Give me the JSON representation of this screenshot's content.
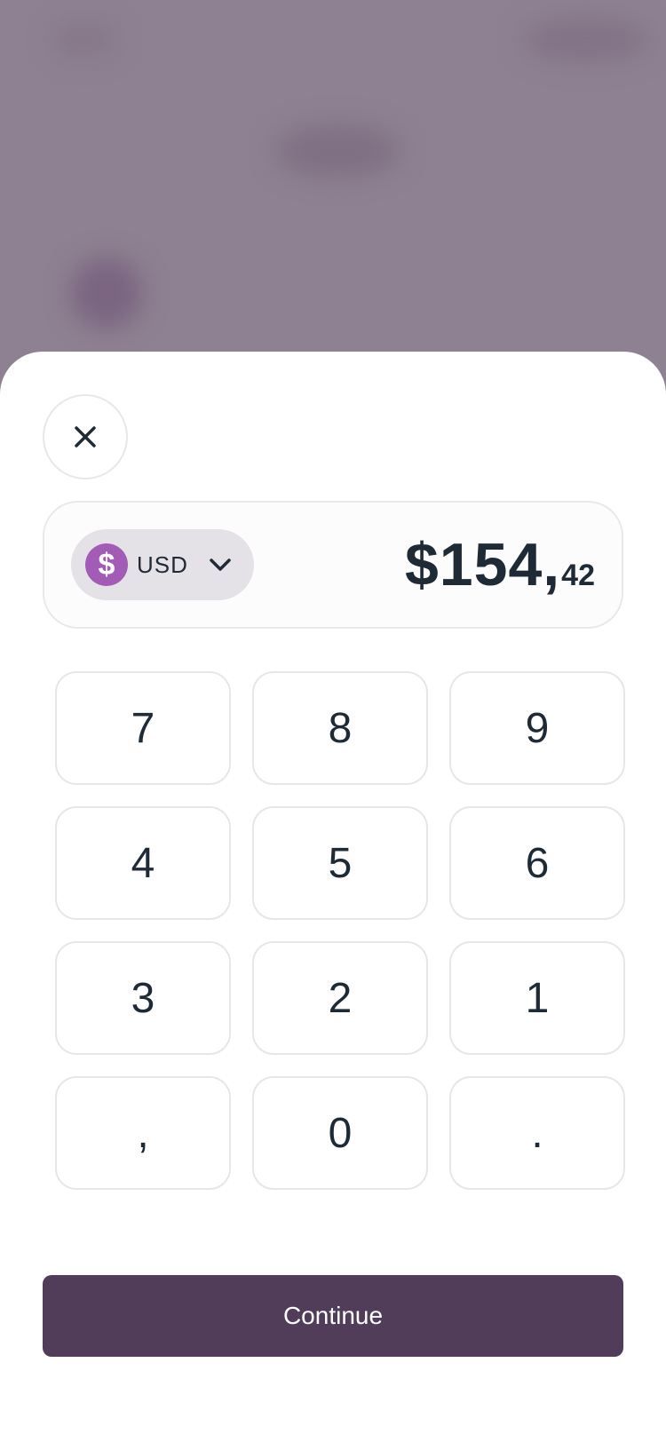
{
  "currency_selector": {
    "symbol": "$",
    "code": "USD",
    "icon": "dollar-icon",
    "accent_color": "#a35cb6"
  },
  "amount": {
    "main": "$154",
    "separator": ",",
    "decimals": "42"
  },
  "keypad": {
    "keys": [
      "7",
      "8",
      "9",
      "4",
      "5",
      "6",
      "3",
      "2",
      "1",
      ",",
      "0",
      "."
    ]
  },
  "continue_button": {
    "label": "Continue",
    "color": "#513d59"
  },
  "icons": {
    "close": "close-icon",
    "chevron": "chevron-down-icon"
  }
}
